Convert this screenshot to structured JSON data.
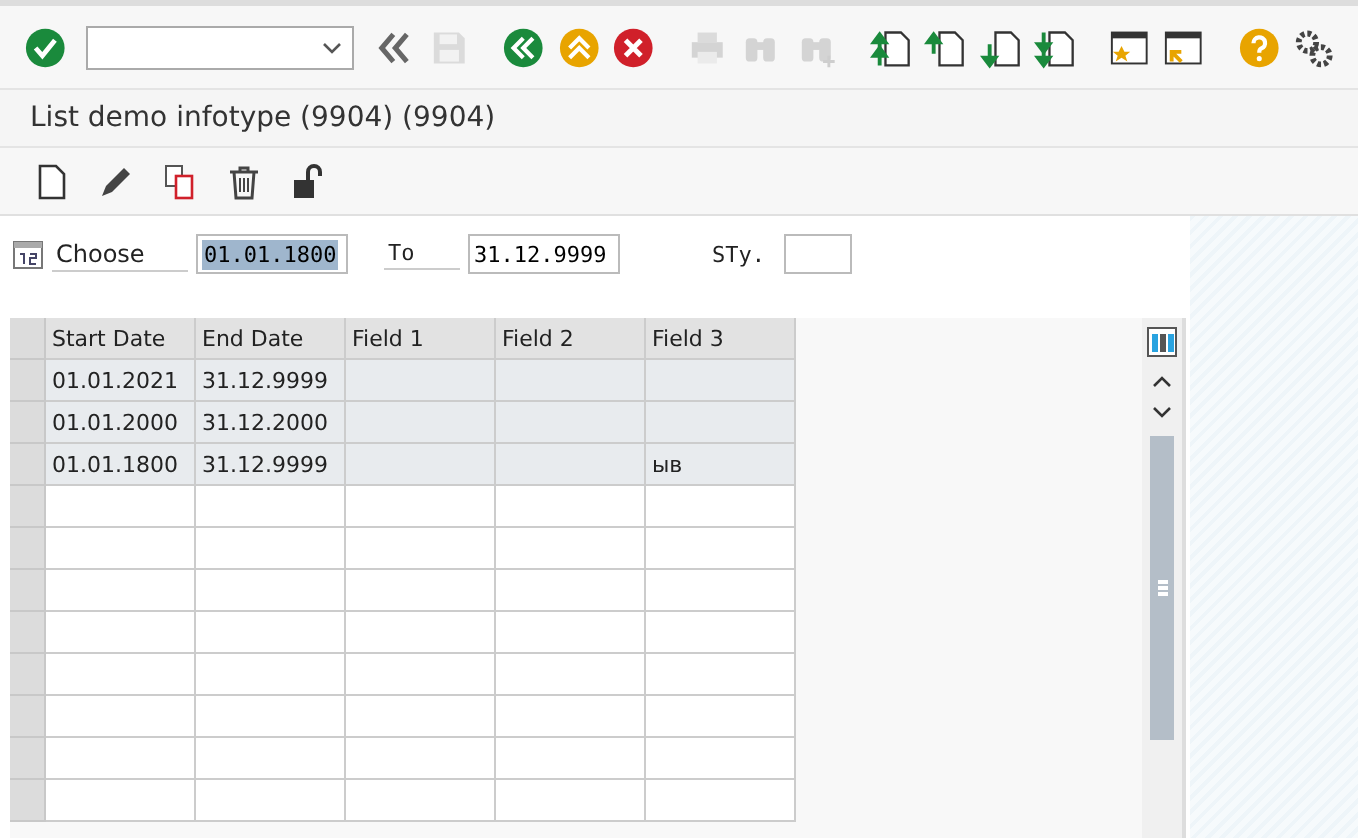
{
  "toolbar": {
    "items": [
      {
        "kind": "check",
        "disabled": false
      },
      {
        "kind": "command-field"
      },
      {
        "kind": "collapse",
        "disabled": false
      },
      {
        "kind": "save",
        "disabled": true
      },
      {
        "kind": "back",
        "disabled": false
      },
      {
        "kind": "exit",
        "disabled": false
      },
      {
        "kind": "cancel",
        "disabled": false
      },
      {
        "kind": "print",
        "disabled": true
      },
      {
        "kind": "find",
        "disabled": true
      },
      {
        "kind": "find-next",
        "disabled": true
      },
      {
        "kind": "first-page",
        "disabled": false
      },
      {
        "kind": "prev-page",
        "disabled": false
      },
      {
        "kind": "next-page",
        "disabled": false
      },
      {
        "kind": "last-page",
        "disabled": false
      },
      {
        "kind": "new-window",
        "disabled": false
      },
      {
        "kind": "shortcut",
        "disabled": false
      },
      {
        "kind": "help",
        "disabled": false
      },
      {
        "kind": "settings",
        "disabled": false
      }
    ]
  },
  "title": "List demo infotype (9904) (9904)",
  "app_toolbar": [
    {
      "kind": "create"
    },
    {
      "kind": "edit"
    },
    {
      "kind": "copy"
    },
    {
      "kind": "delete"
    },
    {
      "kind": "unlock"
    }
  ],
  "selection": {
    "label": "Choose",
    "from": "01.01.1800",
    "from_text_selected": true,
    "to_label": "To",
    "to": "31.12.9999",
    "sty_label": "STy."
  },
  "table": {
    "columns": [
      "Start Date",
      "End Date",
      "Field 1",
      "Field 2",
      "Field 3"
    ],
    "rows": [
      [
        "01.01.2021",
        "31.12.9999",
        "",
        "",
        ""
      ],
      [
        "01.01.2000",
        "31.12.2000",
        "",
        "",
        ""
      ],
      [
        "01.01.1800",
        "31.12.9999",
        "",
        "",
        "ыв"
      ]
    ]
  }
}
